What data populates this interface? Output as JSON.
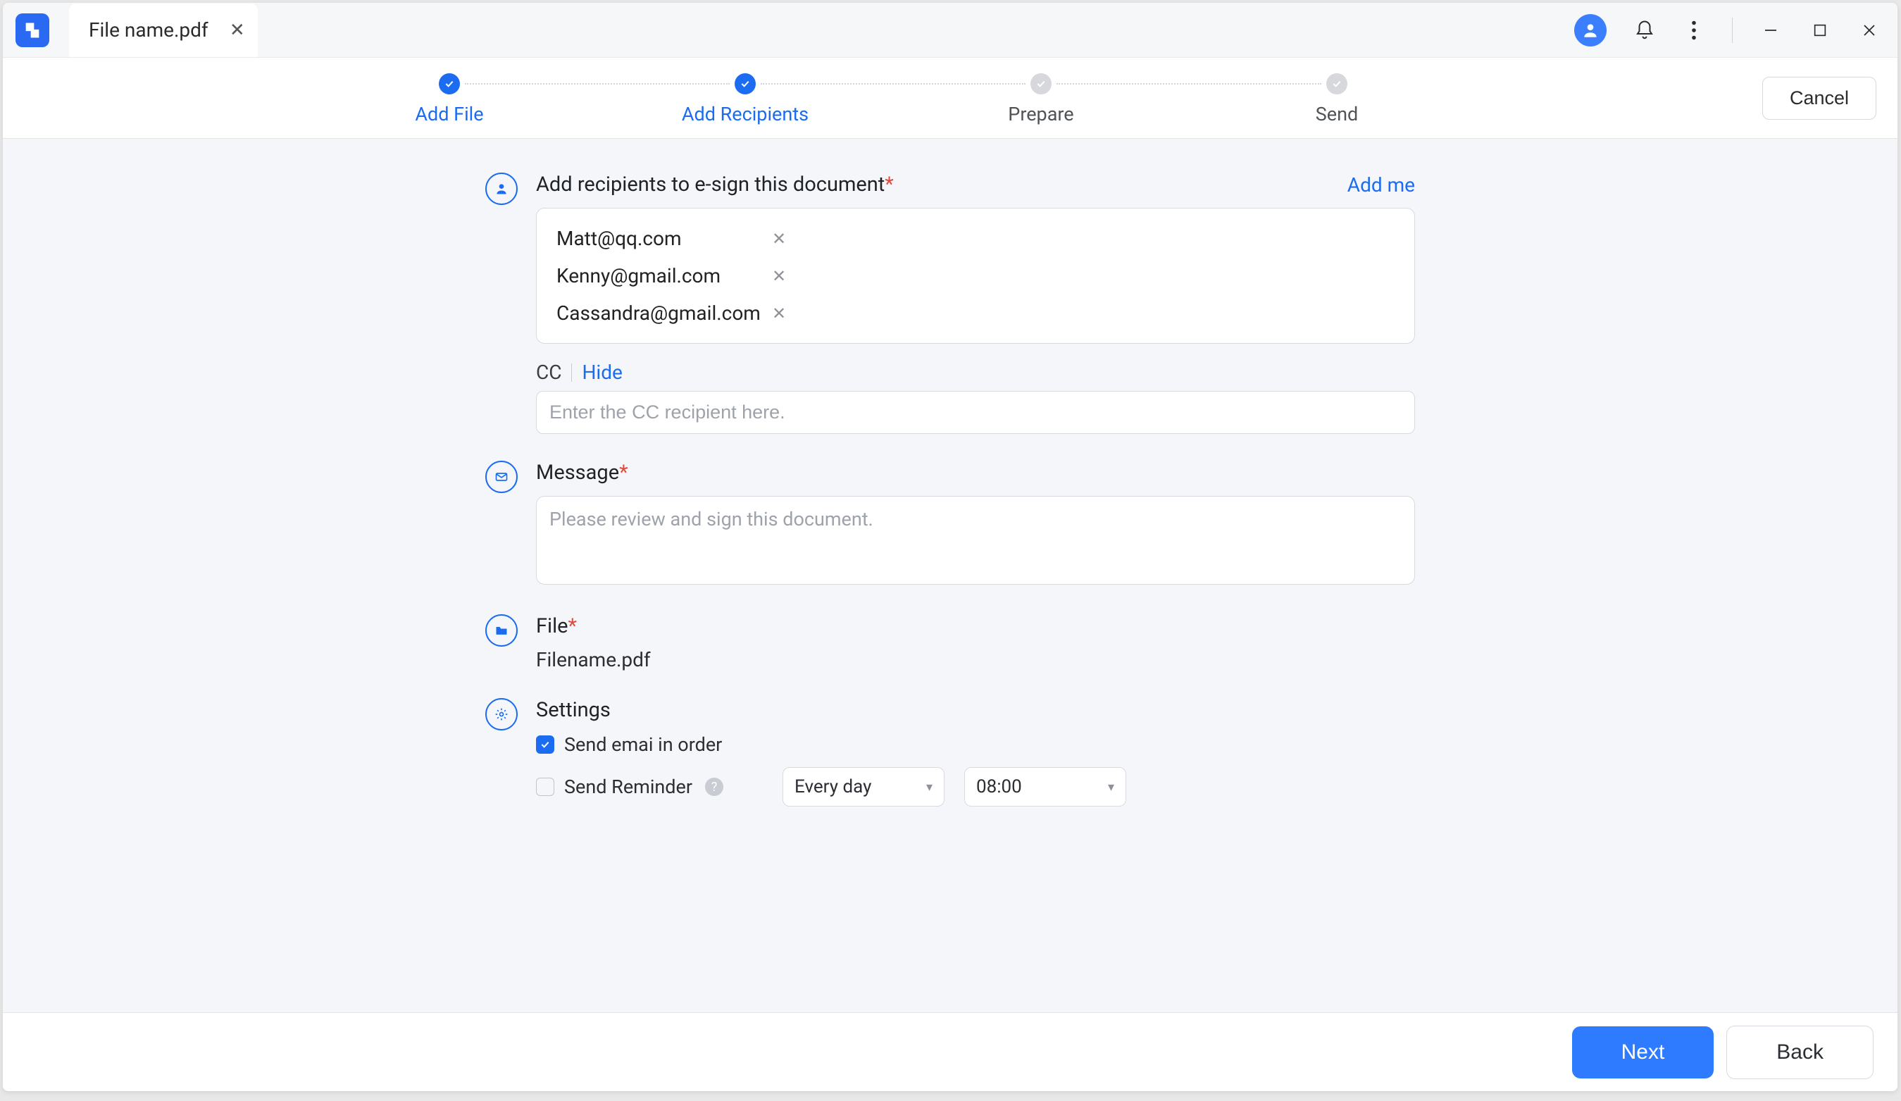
{
  "titlebar": {
    "tab_name": "File name.pdf"
  },
  "stepper": {
    "steps": [
      {
        "label": "Add File",
        "active": true
      },
      {
        "label": "Add Recipients",
        "active": true
      },
      {
        "label": "Prepare",
        "active": false
      },
      {
        "label": "Send",
        "active": false
      }
    ],
    "cancel_label": "Cancel"
  },
  "recipients_section": {
    "title": "Add recipients to e-sign this document",
    "add_me_label": "Add me",
    "recipients": [
      {
        "email": "Matt@qq.com"
      },
      {
        "email": "Kenny@gmail.com"
      },
      {
        "email": "Cassandra@gmail.com"
      }
    ],
    "cc_label": "CC",
    "cc_toggle": "Hide",
    "cc_placeholder": "Enter the CC recipient here."
  },
  "message_section": {
    "title": "Message",
    "placeholder": "Please review and sign this document."
  },
  "file_section": {
    "title": "File",
    "filename": "Filename.pdf"
  },
  "settings_section": {
    "title": "Settings",
    "send_in_order_label": "Send emai in order",
    "send_in_order_checked": true,
    "send_reminder_label": "Send Reminder",
    "send_reminder_checked": false,
    "frequency_value": "Every day",
    "time_value": "08:00"
  },
  "footer": {
    "next_label": "Next",
    "back_label": "Back"
  }
}
